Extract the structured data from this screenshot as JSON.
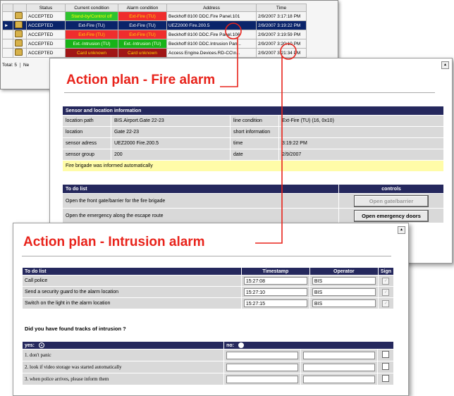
{
  "grid": {
    "headers": [
      "",
      "Status",
      "Current condition",
      "Alarm condition",
      "Address",
      "Time"
    ],
    "rows": [
      {
        "marker": "",
        "status": "ACCEPTED",
        "current": "Stand-by/Control off",
        "alarm": "Ext-Fire (TU)",
        "address": "Beckhoff 8100 DDC.Fire Panel.101",
        "time": "2/9/2007 3:17:18 PM"
      },
      {
        "marker": "►",
        "status": "ACCEPTED",
        "current": "Ext-Fire (TU)",
        "alarm": "Ext-Fire (TU)",
        "address": "UEZ2000 Fire.200.5",
        "time": "2/9/2007 3:19:22 PM"
      },
      {
        "marker": "",
        "status": "ACCEPTED",
        "current": "Ext-Fire (TU)",
        "alarm": "Ext-Fire (TU)",
        "address": "Beckhoff 8100 DDC.Fire Panel.106",
        "time": "2/9/2007 3:19:59 PM"
      },
      {
        "marker": "",
        "status": "ACCEPTED",
        "current": "Ext.-Intrusion (TU)",
        "alarm": "Ext.-Intrusion (TU)",
        "address": "Beckhoff 8100 DDC.Intrusion Pan...",
        "time": "2/9/2007 3:20:10 PM"
      },
      {
        "marker": "",
        "status": "ACCEPTED",
        "current": "Card unknown",
        "alarm": "Card unknown",
        "address": "Access Engine.Devices.RD-CC\\n...",
        "time": "2/9/2007 3:21:34 PM"
      }
    ],
    "footer": {
      "total": "Total: 5",
      "next": "Ne"
    }
  },
  "fire": {
    "title": "Action plan - Fire alarm",
    "sensor_header": "Sensor and location information",
    "info": [
      {
        "k1": "location path",
        "v1": "BIS.Airport.Gate 22-23",
        "k2": "line condition",
        "v2": "Ext-Fire (TU) (16, 0x10)"
      },
      {
        "k1": "location",
        "v1": "Gate 22-23",
        "k2": "short information",
        "v2": ""
      },
      {
        "k1": "sensor adress",
        "v1": "UEZ2000 Fire.200.5",
        "k2": "time",
        "v2": "3:19:22 PM"
      },
      {
        "k1": "sensor group",
        "v1": "200",
        "k2": "date",
        "v2": "2/9/2007"
      }
    ],
    "notice": "Fire brigade was informed automatically",
    "todo_header": "To do list",
    "controls_header": "controls",
    "todo": [
      {
        "task": "Open the front gate/barrier for the fire brigade",
        "button": "Open gate/barrier"
      },
      {
        "task": "Open the emergency along the escape route",
        "button": "Open emergency doors"
      }
    ]
  },
  "intrusion": {
    "title": "Action plan - Intrusion alarm",
    "headers": {
      "todo": "To do list",
      "timestamp": "Timestamp",
      "operator": "Operator",
      "sign": "Sign"
    },
    "todo": [
      {
        "task": "Call police",
        "timestamp": "15:27:08",
        "operator": "BIS"
      },
      {
        "task": "Send a security guard to the alarm location",
        "timestamp": "15:27:10",
        "operator": "BIS"
      },
      {
        "task": "Switch on the light in the alarm location",
        "timestamp": "15:27:15",
        "operator": "BIS"
      }
    ],
    "question": "Did you have found tracks of intrusion ?",
    "yes_label": "yes:",
    "no_label": "no:",
    "tracks": [
      "1. don't panic",
      "2. look if video storage was started automatically",
      "3. when police arrives, please inform them"
    ]
  },
  "colors": {
    "accent": "#e8231b",
    "header_bar": "#25285d",
    "selection": "#0a246a"
  }
}
